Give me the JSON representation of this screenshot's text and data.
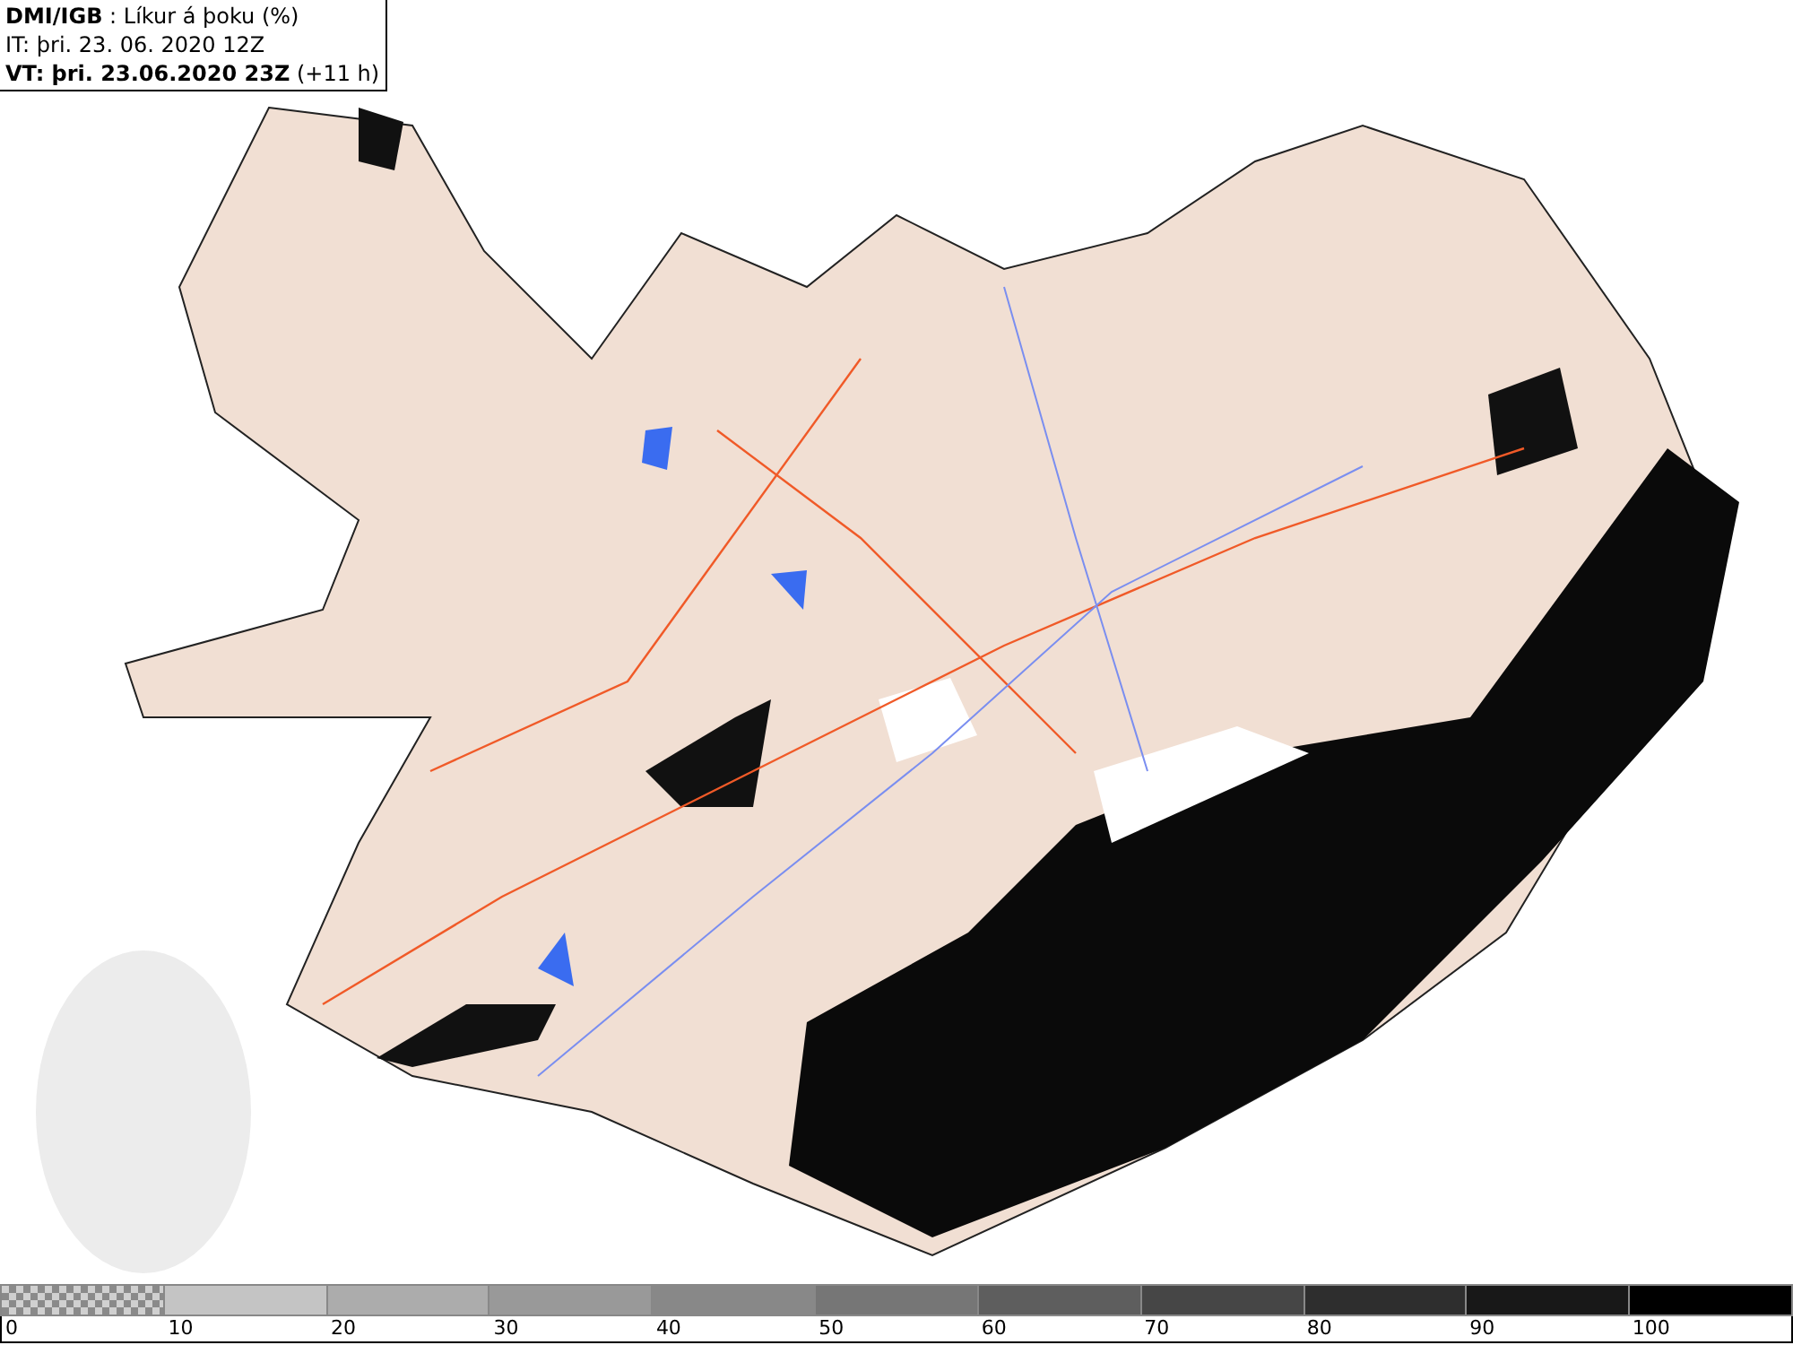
{
  "header": {
    "lines": [
      "**DMI/IGB** : Líkur á þoku (%)",
      "IT: þri. 23. 06. 2020 12Z",
      "**VT: þri. 23.06.2020 23Z** (+11 h)"
    ]
  },
  "legend": {
    "bins": [
      {
        "label": "0",
        "kind": "checker",
        "color": "#8a8a8a"
      },
      {
        "label": "10",
        "kind": "solid",
        "color": "#c4c4c4"
      },
      {
        "label": "20",
        "kind": "solid",
        "color": "#acacac"
      },
      {
        "label": "30",
        "kind": "solid",
        "color": "#999999"
      },
      {
        "label": "40",
        "kind": "solid",
        "color": "#888888"
      },
      {
        "label": "50",
        "kind": "solid",
        "color": "#767676"
      },
      {
        "label": "60",
        "kind": "solid",
        "color": "#5e5e5e"
      },
      {
        "label": "70",
        "kind": "solid",
        "color": "#464646"
      },
      {
        "label": "80",
        "kind": "solid",
        "color": "#2e2e2e"
      },
      {
        "label": "90",
        "kind": "solid",
        "color": "#181818"
      },
      {
        "label": "100",
        "kind": "solid",
        "color": "#000000"
      }
    ]
  }
}
